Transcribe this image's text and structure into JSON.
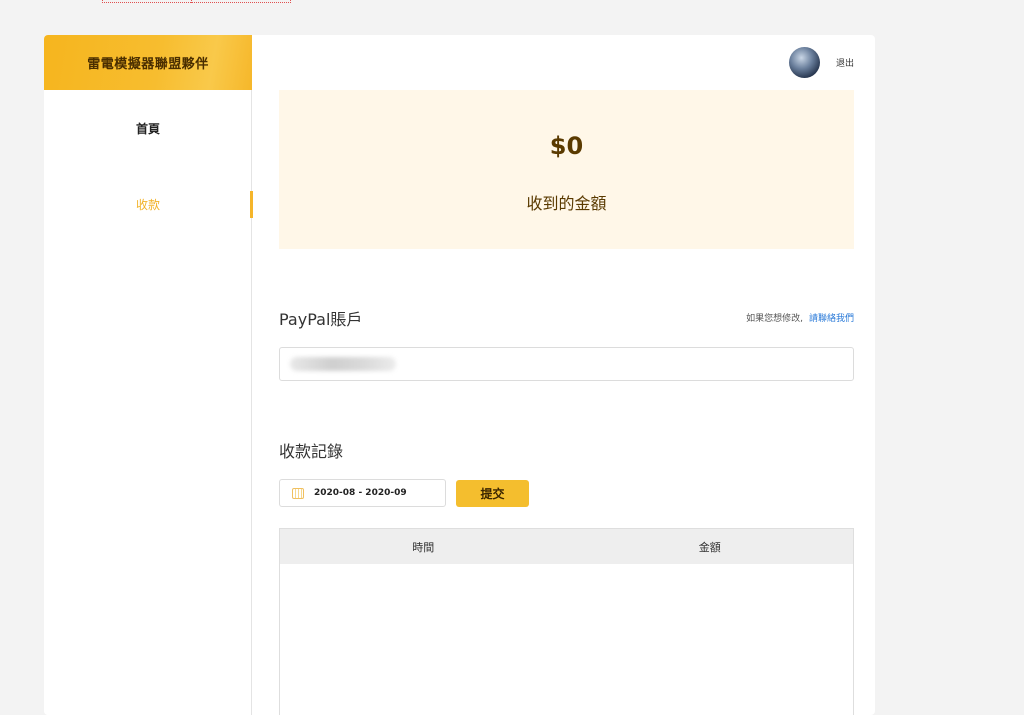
{
  "sidebar": {
    "brand": "雷電模擬器聯盟夥伴",
    "items": [
      {
        "label": "首頁",
        "active": false
      },
      {
        "label": "收款",
        "active": true
      }
    ]
  },
  "header": {
    "logout_label": "退出"
  },
  "balance": {
    "amount": "$0",
    "label": "收到的金額"
  },
  "paypal": {
    "title": "PayPal賬戶",
    "hint": "如果您想修改,",
    "contact_link": "請聯絡我們"
  },
  "records": {
    "title": "收款記錄",
    "date_range": "2020-08 - 2020-09",
    "submit_label": "提交",
    "columns": [
      "時間",
      "金額"
    ],
    "rows": []
  },
  "colors": {
    "accent": "#f4be2e",
    "active_nav": "#f2b227",
    "card_bg": "#fff7e8",
    "link": "#2a7ad8"
  }
}
